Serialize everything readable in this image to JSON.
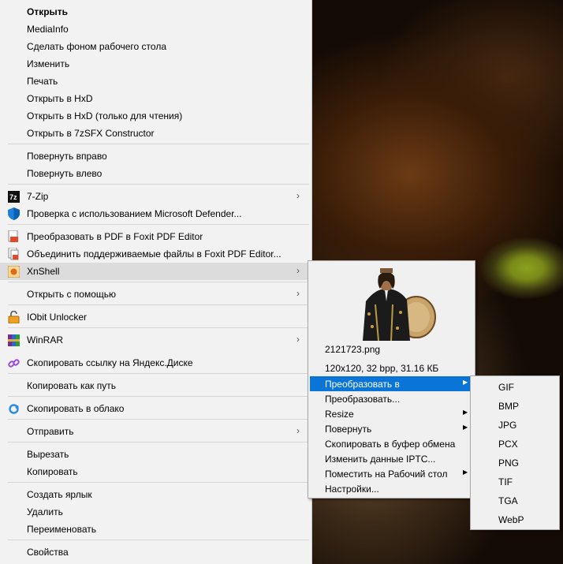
{
  "context_menu": {
    "items": [
      {
        "label": "Открыть"
      },
      {
        "label": "MediaInfo"
      },
      {
        "label": "Сделать фоном рабочего стола"
      },
      {
        "label": "Изменить"
      },
      {
        "label": "Печать"
      },
      {
        "label": "Открыть в HxD"
      },
      {
        "label": "Открыть в HxD (только для чтения)"
      },
      {
        "label": "Открыть в 7zSFX Constructor"
      },
      {
        "label": "Повернуть вправо"
      },
      {
        "label": "Повернуть влево"
      },
      {
        "label": "7-Zip"
      },
      {
        "label": "Проверка с использованием Microsoft Defender..."
      },
      {
        "label": "Преобразовать в PDF в Foxit PDF Editor"
      },
      {
        "label": "Объединить поддерживаемые файлы в Foxit PDF Editor..."
      },
      {
        "label": "XnShell"
      },
      {
        "label": "Открыть с помощью"
      },
      {
        "label": "IObit Unlocker"
      },
      {
        "label": "WinRAR"
      },
      {
        "label": "Скопировать ссылку на Яндекс.Диске"
      },
      {
        "label": "Копировать как путь"
      },
      {
        "label": "Скопировать в облако"
      },
      {
        "label": "Отправить"
      },
      {
        "label": "Вырезать"
      },
      {
        "label": "Копировать"
      },
      {
        "label": "Создать ярлык"
      },
      {
        "label": "Удалить"
      },
      {
        "label": "Переименовать"
      },
      {
        "label": "Свойства"
      }
    ]
  },
  "xnshell_submenu": {
    "file_name": "2121723.png",
    "file_info": "120x120, 32 bpp, 31.16 КБ",
    "items": [
      {
        "label": "Преобразовать в"
      },
      {
        "label": "Преобразовать..."
      },
      {
        "label": "Resize"
      },
      {
        "label": "Повернуть"
      },
      {
        "label": "Скопировать в буфер обмена"
      },
      {
        "label": "Изменить данные IPTC..."
      },
      {
        "label": "Поместить на Рабочий стол"
      },
      {
        "label": "Настройки..."
      }
    ]
  },
  "convert_submenu": {
    "items": [
      {
        "label": "GIF"
      },
      {
        "label": "BMP"
      },
      {
        "label": "JPG"
      },
      {
        "label": "PCX"
      },
      {
        "label": "PNG"
      },
      {
        "label": "TIF"
      },
      {
        "label": "TGA"
      },
      {
        "label": "WebP"
      }
    ]
  },
  "colors": {
    "highlight": "#0a74d7",
    "menu_bg": "#f2f2f2",
    "hover": "#dcdcdc"
  }
}
